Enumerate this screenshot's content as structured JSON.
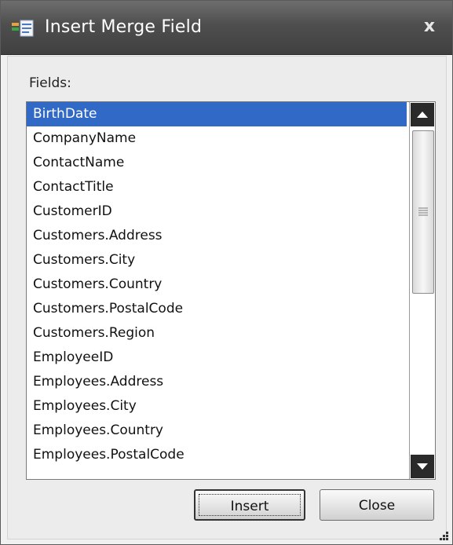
{
  "window": {
    "title": "Insert Merge Field",
    "close_glyph": "x"
  },
  "fields": {
    "label": "Fields:",
    "selected_index": 0,
    "items": [
      "BirthDate",
      "CompanyName",
      "ContactName",
      "ContactTitle",
      "CustomerID",
      "Customers.Address",
      "Customers.City",
      "Customers.Country",
      "Customers.PostalCode",
      "Customers.Region",
      "EmployeeID",
      "Employees.Address",
      "Employees.City",
      "Employees.Country",
      "Employees.PostalCode"
    ]
  },
  "buttons": {
    "insert_label": "Insert",
    "close_label": "Close"
  },
  "icons": {
    "title": "merge-field-icon",
    "scroll_up": "triangle-up-icon",
    "scroll_down": "triangle-down-icon",
    "thumb_grip": "grip-lines-icon",
    "resize": "resize-grip-icon"
  },
  "colors": {
    "selection": "#3169c6",
    "titlebar": "#4e4e4e"
  }
}
